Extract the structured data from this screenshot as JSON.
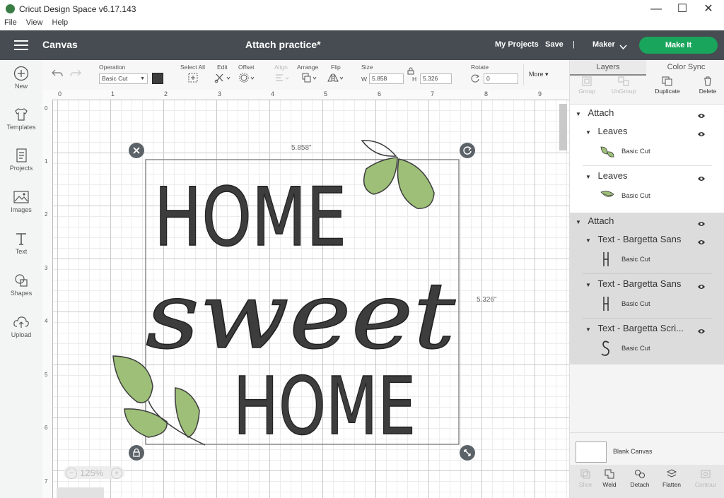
{
  "window": {
    "title": "Cricut Design Space  v6.17.143",
    "controls": [
      "—",
      "☐",
      "✕"
    ]
  },
  "menu": [
    "File",
    "View",
    "Help"
  ],
  "header": {
    "section": "Canvas",
    "doc_title": "Attach practice*",
    "my_projects": "My Projects",
    "save": "Save",
    "separator": "|",
    "machine": "Maker",
    "make_it": "Make It"
  },
  "sidebar": [
    {
      "label": "New",
      "icon": "plus-circle-icon"
    },
    {
      "label": "Templates",
      "icon": "shirt-icon"
    },
    {
      "label": "Projects",
      "icon": "projects-icon"
    },
    {
      "label": "Images",
      "icon": "image-icon"
    },
    {
      "label": "Text",
      "icon": "text-icon"
    },
    {
      "label": "Shapes",
      "icon": "shapes-icon"
    },
    {
      "label": "Upload",
      "icon": "upload-icon"
    }
  ],
  "toolbar": {
    "operation_label": "Operation",
    "operation_value": "Basic Cut",
    "select_all": "Select All",
    "edit": "Edit",
    "offset": "Offset",
    "align": "Align",
    "arrange": "Arrange",
    "flip": "Flip",
    "size_label": "Size",
    "w_label": "W",
    "w_value": "5.858",
    "h_label": "H",
    "h_value": "5.326",
    "rotate_label": "Rotate",
    "rotate_value": "0",
    "more": "More"
  },
  "ruler": {
    "top": [
      "0",
      "1",
      "2",
      "3",
      "4",
      "5",
      "6",
      "7",
      "8",
      "9"
    ],
    "left": [
      "0",
      "1",
      "2",
      "3",
      "4",
      "5",
      "6",
      "7"
    ]
  },
  "canvas": {
    "width_label": "5.858\"",
    "height_label": "5.326\"",
    "zoom": "125%",
    "design_lines": [
      "HOME",
      "sweet",
      "HOME"
    ],
    "text_color": "#3d3d3d",
    "leaf_color": "#9dbf78"
  },
  "layers_panel": {
    "tab_layers": "Layers",
    "tab_color_sync": "Color Sync",
    "actions": [
      "Group",
      "UnGroup",
      "Duplicate",
      "Delete"
    ],
    "groups": [
      {
        "name": "Attach",
        "items": [
          {
            "name": "Leaves",
            "op": "Basic Cut"
          },
          {
            "name": "Leaves",
            "op": "Basic Cut"
          }
        ]
      },
      {
        "name": "Attach",
        "items": [
          {
            "name": "Text - Bargetta Sans",
            "op": "Basic Cut"
          },
          {
            "name": "Text - Bargetta Sans",
            "op": "Basic Cut"
          },
          {
            "name": "Text - Bargetta Scri...",
            "op": "Basic Cut"
          }
        ]
      }
    ],
    "blank_canvas": "Blank Canvas",
    "bottom_actions": [
      "Slice",
      "Weld",
      "Detach",
      "Flatten",
      "Contour"
    ]
  }
}
